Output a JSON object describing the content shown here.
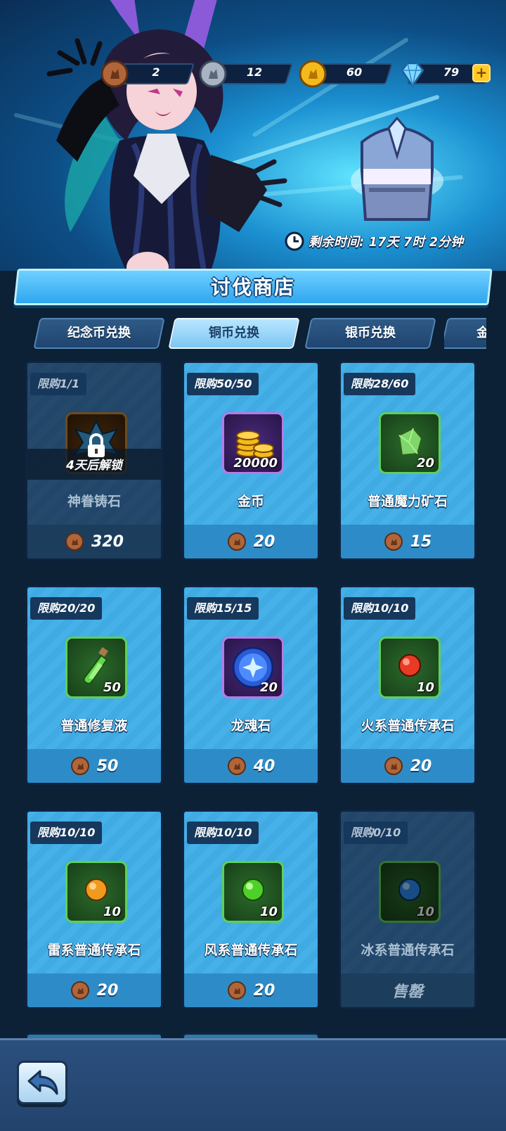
{
  "currencies": [
    {
      "id": "memorial-coin",
      "value": "2"
    },
    {
      "id": "silver-coin",
      "value": "12"
    },
    {
      "id": "gold-coin",
      "value": "60"
    },
    {
      "id": "diamond",
      "value": "79"
    }
  ],
  "plus_label": "+",
  "timer": {
    "text": "剩余时间: 17天 7时 2分钟"
  },
  "shop_title": "讨伐商店",
  "tabs": [
    {
      "label": "纪念币兑换",
      "active": false
    },
    {
      "label": "铜币兑换",
      "active": true
    },
    {
      "label": "银币兑换",
      "active": false
    },
    {
      "label": "金",
      "active": false
    }
  ],
  "items": [
    {
      "limit": "限购1/1",
      "name": "神眷铸石",
      "price": "320",
      "locked": true,
      "lock_text": "4天后解锁",
      "icon": "lock-icon",
      "qty": ""
    },
    {
      "limit": "限购50/50",
      "name": "金币",
      "price": "20",
      "icon": "gold-coins-icon",
      "qty": "20000"
    },
    {
      "limit": "限购28/60",
      "name": "普通魔力矿石",
      "price": "15",
      "icon": "green-ore-icon",
      "qty": "20"
    },
    {
      "limit": "限购20/20",
      "name": "普通修复液",
      "price": "50",
      "icon": "potion-icon",
      "qty": "50"
    },
    {
      "limit": "限购15/15",
      "name": "龙魂石",
      "price": "40",
      "icon": "dragon-soul-icon",
      "qty": "20"
    },
    {
      "limit": "限购10/10",
      "name": "火系普通传承石",
      "price": "20",
      "icon": "red-orb-icon",
      "qty": "10"
    },
    {
      "limit": "限购10/10",
      "name": "雷系普通传承石",
      "price": "20",
      "icon": "orange-orb-icon",
      "qty": "10"
    },
    {
      "limit": "限购10/10",
      "name": "风系普通传承石",
      "price": "20",
      "icon": "green-orb-icon",
      "qty": "10"
    },
    {
      "limit": "限购0/10",
      "name": "冰系普通传承石",
      "sold_out": "售罄",
      "icon": "blue-orb-icon",
      "qty": "10"
    }
  ]
}
